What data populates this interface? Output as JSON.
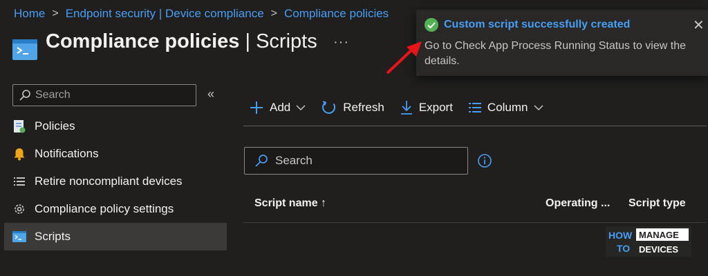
{
  "breadcrumb": {
    "items": [
      "Home",
      "Endpoint security | Device compliance",
      "Compliance policies"
    ]
  },
  "header": {
    "title_bold": "Compliance policies",
    "title_sep": " | ",
    "title_rest": "Scripts",
    "more": "···"
  },
  "sidebar": {
    "search_placeholder": "Search",
    "collapse": "«",
    "items": [
      {
        "label": "Policies",
        "icon": "policy-icon"
      },
      {
        "label": "Notifications",
        "icon": "bell-icon"
      },
      {
        "label": "Retire noncompliant devices",
        "icon": "list-icon"
      },
      {
        "label": "Compliance policy settings",
        "icon": "gear-icon"
      },
      {
        "label": "Scripts",
        "icon": "script-icon",
        "active": true
      }
    ]
  },
  "toolbar": {
    "add_label": "Add",
    "refresh_label": "Refresh",
    "export_label": "Export",
    "column_label": "Column"
  },
  "main": {
    "search_placeholder": "Search",
    "table": {
      "columns": [
        "Script name ↑",
        "Operating ...",
        "Script type"
      ]
    }
  },
  "toast": {
    "title": "Custom script successfully created",
    "body": "Go to Check App Process Running Status to view the details.",
    "close": "✕"
  },
  "watermark": {
    "line1": "HOW",
    "line2": "TO",
    "line3": "MANAGE",
    "line4": "DEVICES"
  },
  "colors": {
    "accent": "#479ef5",
    "background": "#201f1e",
    "success": "#54b054",
    "arrow": "#e8141a"
  }
}
